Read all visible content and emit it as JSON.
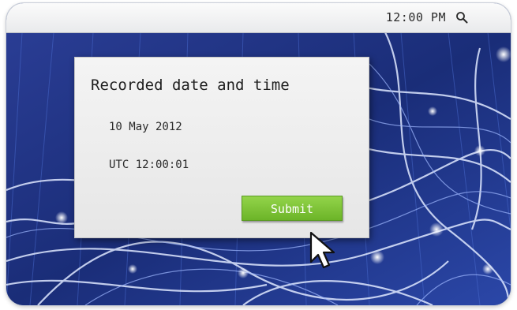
{
  "menu_bar": {
    "clock": "12:00 PM",
    "search_icon": "search-icon"
  },
  "dialog": {
    "title": "Recorded date and time",
    "date": "10 May 2012",
    "time": "UTC 12:00:01",
    "submit_label": "Submit"
  },
  "desktop": {
    "wallpaper": "abstract-network-wallpaper"
  },
  "colors": {
    "accent_button": "#7cc236",
    "wallpaper_base": "#1c2f7a",
    "menu_bar": "#f2f3f5",
    "dialog_background": "#eeeeee"
  }
}
